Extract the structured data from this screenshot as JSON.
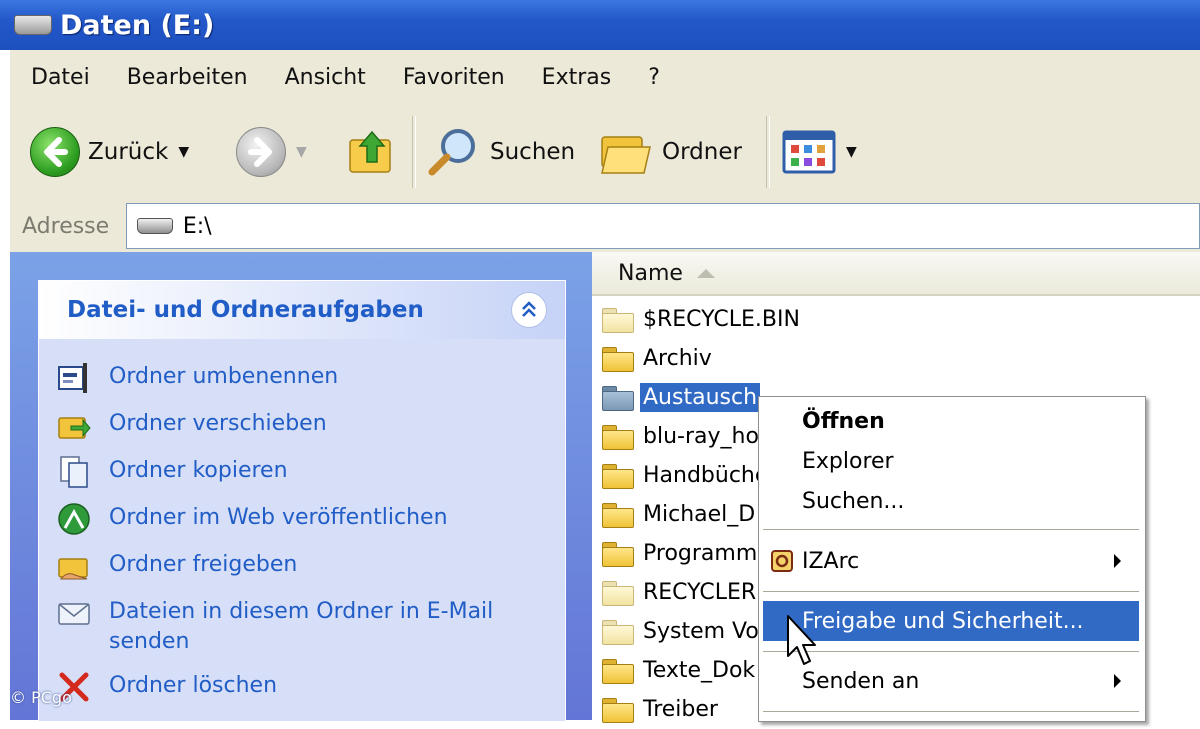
{
  "window": {
    "title": "Daten (E:)"
  },
  "menu": [
    "Datei",
    "Bearbeiten",
    "Ansicht",
    "Favoriten",
    "Extras",
    "?"
  ],
  "toolbar": {
    "back_label": "Zurück",
    "search_label": "Suchen",
    "folders_label": "Ordner"
  },
  "address": {
    "label": "Adresse",
    "value": "E:\\"
  },
  "tasks": {
    "title": "Datei- und Ordneraufgaben",
    "items": [
      {
        "label": "Ordner umbenennen",
        "icon": "rename-icon"
      },
      {
        "label": "Ordner verschieben",
        "icon": "move-icon"
      },
      {
        "label": "Ordner kopieren",
        "icon": "copy-icon"
      },
      {
        "label": "Ordner im Web veröffentlichen",
        "icon": "web-publish-icon"
      },
      {
        "label": "Ordner freigeben",
        "icon": "share-icon"
      },
      {
        "label": "Dateien in diesem Ordner in E-Mail senden",
        "icon": "email-icon"
      },
      {
        "label": "Ordner löschen",
        "icon": "delete-icon"
      }
    ]
  },
  "list": {
    "column_name": "Name",
    "files": [
      "$RECYCLE.BIN",
      "Archiv",
      "Austausch",
      "blu-ray_ho",
      "Handbüche",
      "Michael_D",
      "Programme",
      "RECYCLER",
      "System Vo",
      "Texte_Dok",
      "Treiber"
    ]
  },
  "context_menu": {
    "items": [
      "Öffnen",
      "Explorer",
      "Suchen...",
      "IZArc",
      "Freigabe und Sicherheit...",
      "Senden an"
    ]
  },
  "watermark": "© PCgo"
}
